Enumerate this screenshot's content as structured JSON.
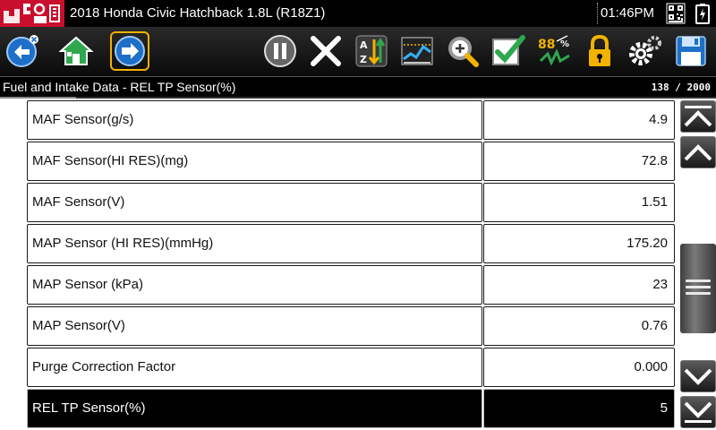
{
  "titlebar": {
    "logo_text": "ᴿ⁰ᴹ",
    "vehicle": "2018 Honda Civic Hatchback 1.8L (R18Z1)",
    "time": "01:46PM"
  },
  "toolbar": {
    "buttons": [
      {
        "name": "back-button",
        "icon": "back-arrow-icon"
      },
      {
        "name": "home-button",
        "icon": "home-icon"
      },
      {
        "name": "forward-button",
        "icon": "forward-arrow-icon",
        "selected": true
      },
      {
        "name": "pause-button",
        "icon": "pause-icon"
      },
      {
        "name": "clear-button",
        "icon": "x-icon"
      },
      {
        "name": "sort-button",
        "icon": "sort-az-icon"
      },
      {
        "name": "graph-button",
        "icon": "graph-icon"
      },
      {
        "name": "zoom-button",
        "icon": "zoom-icon"
      },
      {
        "name": "custom-list-button",
        "icon": "checkmark-icon"
      },
      {
        "name": "units-button",
        "icon": "units-88-icon",
        "label": "88"
      },
      {
        "name": "lock-button",
        "icon": "lock-icon"
      },
      {
        "name": "settings-button",
        "icon": "gear-icon"
      },
      {
        "name": "save-button",
        "icon": "floppy-disk-icon"
      }
    ]
  },
  "header": {
    "title": "Fuel and Intake Data - REL TP Sensor(%)",
    "count": "138 / 2000"
  },
  "recording_progress": 0.106,
  "rows": [
    {
      "name": "MAF Sensor(g/s)",
      "value": "4.9"
    },
    {
      "name": "MAF Sensor(HI RES)(mg)",
      "value": "72.8"
    },
    {
      "name": "MAF Sensor(V)",
      "value": "1.51"
    },
    {
      "name": "MAP Sensor (HI RES)(mmHg)",
      "value": "175.20"
    },
    {
      "name": "MAP Sensor (kPa)",
      "value": "23"
    },
    {
      "name": "MAP Sensor(V)",
      "value": "0.76"
    },
    {
      "name": "Purge Correction Factor",
      "value": "0.000"
    },
    {
      "name": "REL TP Sensor(%)",
      "value": "5",
      "selected": true
    }
  ],
  "scrollbar": {
    "buttons": [
      "scroll-top-icon",
      "scroll-up-icon",
      "scroll-down-icon",
      "scroll-bottom-icon"
    ]
  },
  "colors": {
    "brand_red": "#c8102e",
    "toolbar_blue": "#1e6fc8",
    "selection_outline": "#f2b200"
  }
}
